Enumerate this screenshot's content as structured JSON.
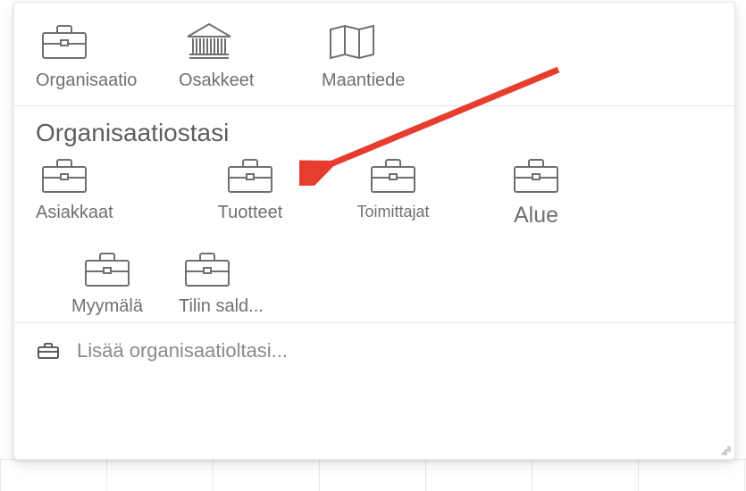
{
  "categories": [
    {
      "name": "organisaatio",
      "icon": "briefcase-icon",
      "label": "Organisaatio"
    },
    {
      "name": "osakkeet",
      "icon": "building-icon",
      "label": "Osakkeet"
    },
    {
      "name": "maantiede",
      "icon": "map-icon",
      "label": "Maantiede"
    }
  ],
  "section_title": "Organisaatiostasi",
  "org_items": [
    {
      "name": "asiakkaat",
      "icon": "briefcase-icon",
      "label": "Asiakkaat"
    },
    {
      "name": "tuotteet",
      "icon": "briefcase-icon",
      "label": "Tuotteet"
    },
    {
      "name": "toimittajat",
      "icon": "briefcase-icon",
      "label": "Toimittajat"
    },
    {
      "name": "alue",
      "icon": "briefcase-icon",
      "label": "Alue"
    },
    {
      "name": "myymala",
      "icon": "briefcase-icon",
      "label": "Myymälä"
    },
    {
      "name": "tilin-saldo",
      "icon": "briefcase-icon",
      "label": "Tilin sald..."
    }
  ],
  "footer": {
    "icon": "briefcase-icon",
    "label": "Lisää organisaatioltasi..."
  }
}
